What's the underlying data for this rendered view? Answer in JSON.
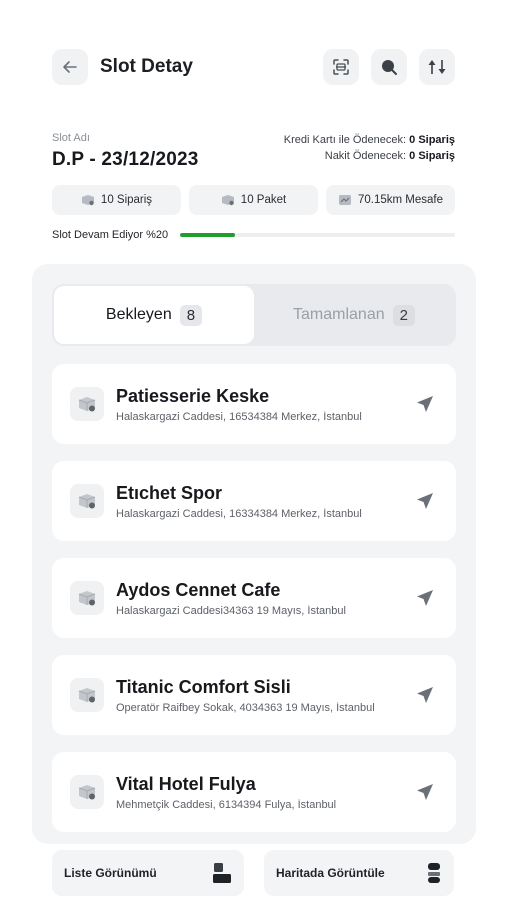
{
  "header": {
    "title": "Slot Detay",
    "back_icon": "arrow-left-icon",
    "actions": [
      "scan-icon",
      "search-icon",
      "sort-icon"
    ]
  },
  "slot": {
    "label": "Slot Adı",
    "name": "D.P - 23/12/2023",
    "card_payment_label": "Kredi Kartı ile Ödenecek:",
    "card_payment_value": "0 Sipariş",
    "cash_payment_label": "Nakit Ödenecek:",
    "cash_payment_value": "0 Sipariş"
  },
  "stats": {
    "orders": "10 Sipariş",
    "packages": "10 Paket",
    "distance": "70.15km Mesafe"
  },
  "progress": {
    "label": "Slot Devam Ediyor %20",
    "percent": 20,
    "color": "#1f9d2e"
  },
  "tabs": [
    {
      "label": "Bekleyen",
      "count": "8",
      "active": true
    },
    {
      "label": "Tamamlanan",
      "count": "2",
      "active": false
    }
  ],
  "stores": [
    {
      "name": "Patiesserie Keske",
      "address": "Halaskargazi Caddesi, 16534384 Merkez, İstanbul"
    },
    {
      "name": "Etıchet Spor",
      "address": "Halaskargazi Caddesi, 16334384 Merkez, İstanbul"
    },
    {
      "name": "Aydos Cennet Cafe",
      "address": "Halaskargazi Caddesi34363 19 Mayıs, İstanbul"
    },
    {
      "name": "Titanic Comfort Sisli",
      "address": "Operatör Raifbey Sokak, 4034363 19 Mayıs, İstanbul"
    },
    {
      "name": "Vital Hotel Fulya",
      "address": "Mehmetçik Caddesi, 6134394 Fulya, İstanbul"
    }
  ],
  "bottom": {
    "list_view": "Liste Görünümü",
    "map_view": "Haritada Görüntüle"
  }
}
